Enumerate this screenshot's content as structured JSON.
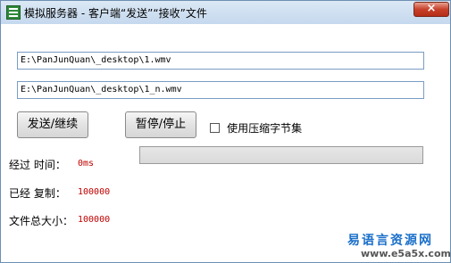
{
  "window": {
    "title": "模拟服务器 - 客户端“发送”“接收”文件",
    "close_glyph": "×"
  },
  "fields": {
    "source_path": "E:\\PanJunQuan\\_desktop\\1.wmv",
    "dest_path": "E:\\PanJunQuan\\_desktop\\1_n.wmv"
  },
  "buttons": {
    "send_continue": "发送/继续",
    "pause_stop": "暂停/停止"
  },
  "checkbox": {
    "label": "使用压缩字节集",
    "checked": false
  },
  "progress": {
    "value": 0
  },
  "stats": {
    "elapsed_label": "经过 时间：",
    "elapsed_value": "0ms",
    "copied_label": "已经 复制：",
    "copied_value": "100000",
    "total_label": "文件总大小：",
    "total_value": "100000"
  },
  "watermark": {
    "brand": "易语言资源网",
    "url": "www.e5a5x.com"
  },
  "colors": {
    "value_text": "#c00000",
    "progress_fill": "#3cb043",
    "watermark": "#1a6fc9"
  }
}
